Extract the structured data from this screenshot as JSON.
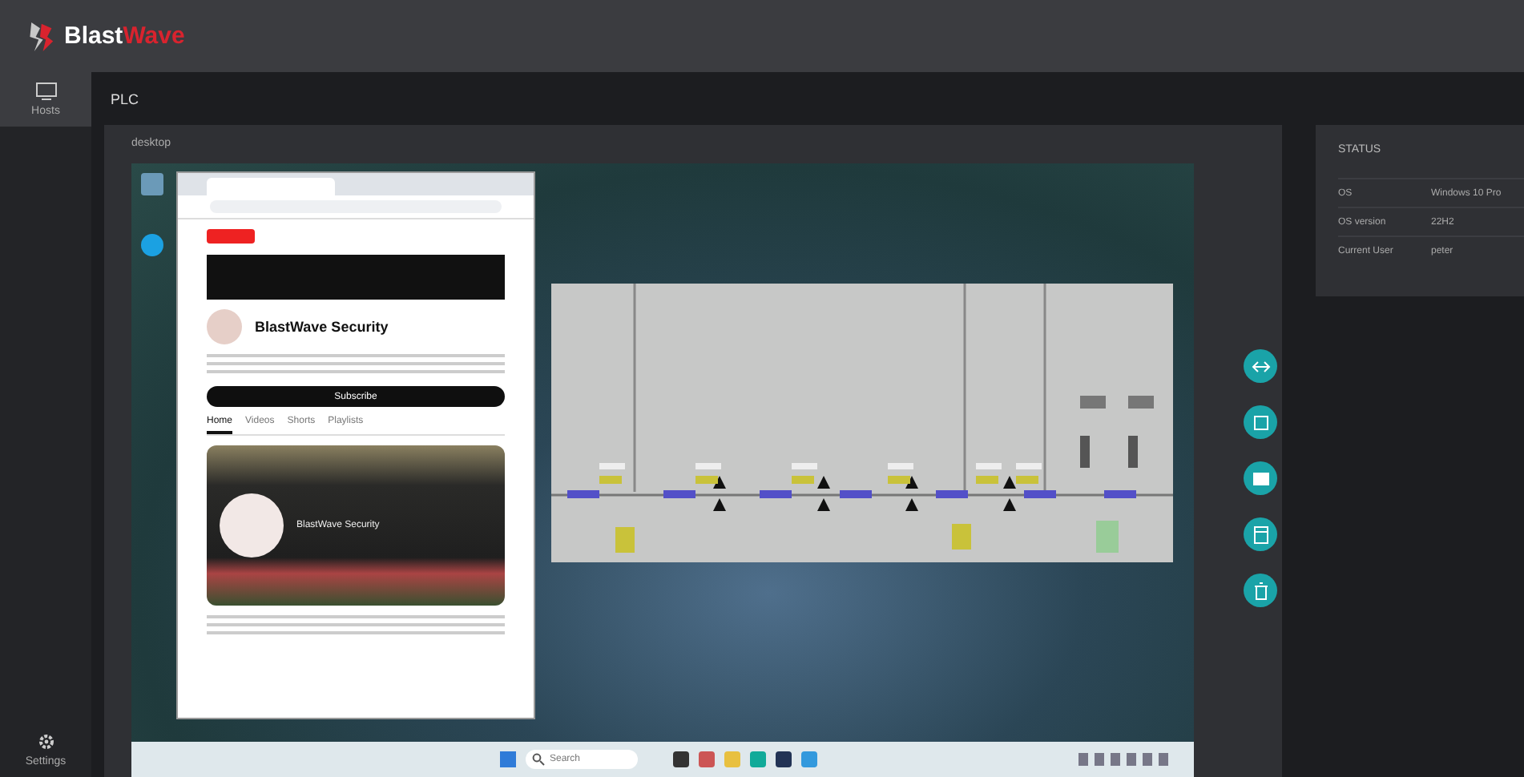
{
  "app": {
    "logo_primary": "Blast",
    "logo_accent": "Wave"
  },
  "sidebar": {
    "items": [
      {
        "label": "Hosts",
        "selected": true
      }
    ],
    "footer": {
      "label": "Settings"
    }
  },
  "page_title": "PLC",
  "desktop_panel": {
    "title": "desktop",
    "browser": {
      "channel_name": "BlastWave Security",
      "subscribe": "Subscribe",
      "tabs": [
        {
          "label": "Home",
          "selected": true
        },
        {
          "label": "Videos",
          "selected": false
        },
        {
          "label": "Shorts",
          "selected": false
        },
        {
          "label": "Playlists",
          "selected": false
        }
      ],
      "video_channel": "BlastWave Security"
    },
    "taskbar": {
      "search_placeholder": "Search"
    }
  },
  "status": {
    "title": "STATUS",
    "rows": [
      {
        "label": "OS",
        "value": "Windows 10 Pro"
      },
      {
        "label": "OS version",
        "value": "22H2"
      },
      {
        "label": "Current User",
        "value": "peter"
      }
    ]
  }
}
